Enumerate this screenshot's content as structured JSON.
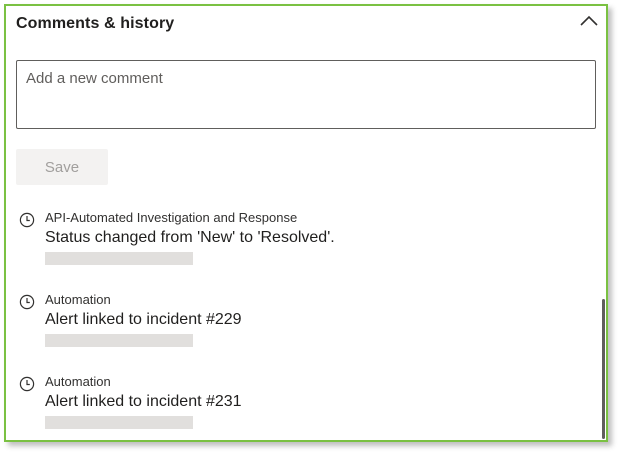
{
  "panel": {
    "title": "Comments & history",
    "collapse_icon": "chevron-up-icon"
  },
  "comment": {
    "placeholder": "Add a new comment",
    "value": ""
  },
  "save_button": {
    "label": "Save",
    "enabled": false
  },
  "history": [
    {
      "icon": "clock-icon",
      "actor": "API-Automated Investigation and Response",
      "text": "Status changed from 'New' to 'Resolved'."
    },
    {
      "icon": "clock-icon",
      "actor": "Automation",
      "text": "Alert linked to incident #229"
    },
    {
      "icon": "clock-icon",
      "actor": "Automation",
      "text": "Alert linked to incident #231"
    }
  ],
  "colors": {
    "frame_border": "#7ac142",
    "text": "#201f1e",
    "disabled_bg": "#f3f2f1",
    "disabled_text": "#a19f9d",
    "redaction": "#e1dfdd"
  }
}
